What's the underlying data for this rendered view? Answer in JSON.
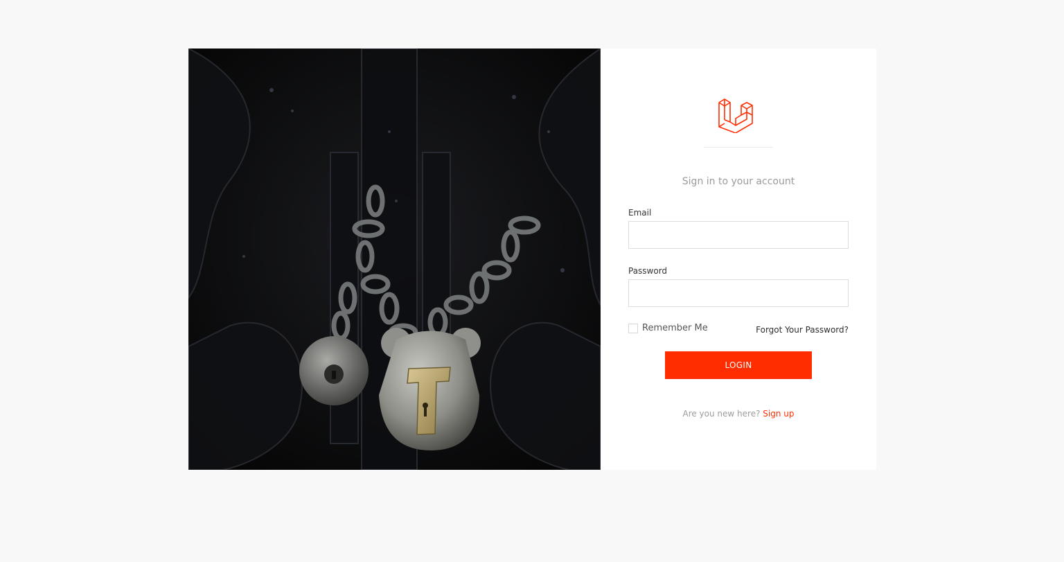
{
  "brand": {
    "logo_icon": "laravel-logo-icon",
    "accent_color": "#ff2d00"
  },
  "hero": {
    "image_icon": "padlock-photo"
  },
  "form": {
    "subtitle": "Sign in to your account",
    "email_label": "Email",
    "email_value": "",
    "password_label": "Password",
    "password_value": "",
    "remember_label": "Remember Me",
    "remember_checked": false,
    "forgot_link": "Forgot Your Password?",
    "login_button": "LOGIN",
    "signup_prompt": "Are you new here?",
    "signup_link": "Sign up"
  }
}
